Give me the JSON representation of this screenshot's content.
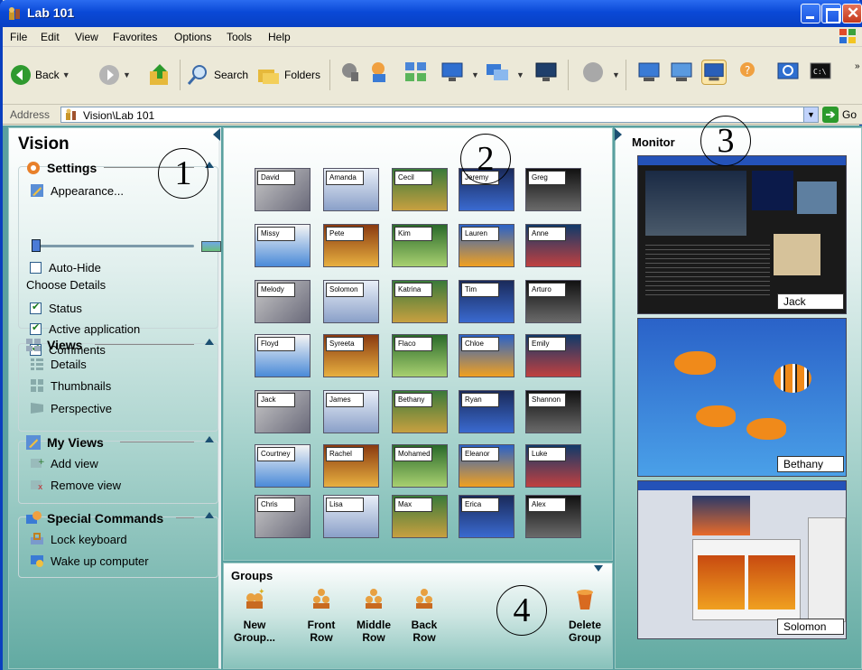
{
  "window": {
    "title": "Lab 101"
  },
  "menu": [
    "File",
    "Edit",
    "View",
    "Favorites",
    "Options",
    "Tools",
    "Help"
  ],
  "toolbar": {
    "back_label": "Back",
    "search_label": "Search",
    "folders_label": "Folders"
  },
  "address": {
    "label": "Address",
    "value": "Vision\\Lab 101",
    "go_label": "Go"
  },
  "left": {
    "title": "Vision",
    "settings": {
      "heading": "Settings",
      "appearance": "Appearance...",
      "auto_hide": "Auto-Hide",
      "choose_details": "Choose Details",
      "details": [
        {
          "label": "Status",
          "checked": true
        },
        {
          "label": "Active application",
          "checked": true
        },
        {
          "label": "Comments",
          "checked": true
        }
      ]
    },
    "views": {
      "heading": "Views",
      "items": [
        "Details",
        "Thumbnails",
        "Perspective"
      ]
    },
    "my_views": {
      "heading": "My Views",
      "items": [
        "Add view",
        "Remove view"
      ]
    },
    "special": {
      "heading": "Special Commands",
      "items": [
        "Lock keyboard",
        "Wake up computer"
      ]
    }
  },
  "students": [
    [
      "David",
      "Amanda",
      "Cecil",
      "Jeremy",
      "Greg"
    ],
    [
      "Missy",
      "Pete",
      "Kim",
      "Lauren",
      "Anne"
    ],
    [
      "Melody",
      "Solomon",
      "Katrina",
      "Tim",
      "Arturo"
    ],
    [
      "Floyd",
      "Syreeta",
      "Flaco",
      "Chloe",
      "Emily"
    ],
    [
      "Jack",
      "James",
      "Bethany",
      "Ryan",
      "Shannon"
    ],
    [
      "Courtney",
      "Rachel",
      "Mohamed",
      "Eleanor",
      "Luke"
    ],
    [
      "Chris",
      "Lisa",
      "Max",
      "Erica",
      "Alex"
    ]
  ],
  "monitor": {
    "title": "Monitor",
    "screens": [
      "Jack",
      "Bethany",
      "Solomon"
    ]
  },
  "groups": {
    "title": "Groups",
    "buttons": [
      {
        "l1": "New",
        "l2": "Group..."
      },
      {
        "l1": "Front",
        "l2": "Row"
      },
      {
        "l1": "Middle",
        "l2": "Row"
      },
      {
        "l1": "Back",
        "l2": "Row"
      }
    ],
    "delete": {
      "l1": "Delete",
      "l2": "Group"
    }
  },
  "callouts": [
    "1",
    "2",
    "3",
    "4"
  ],
  "colors": {
    "titlebar": "#0a49d6",
    "pane_teal": "#62aaa2",
    "accent": "#1b4f72"
  }
}
